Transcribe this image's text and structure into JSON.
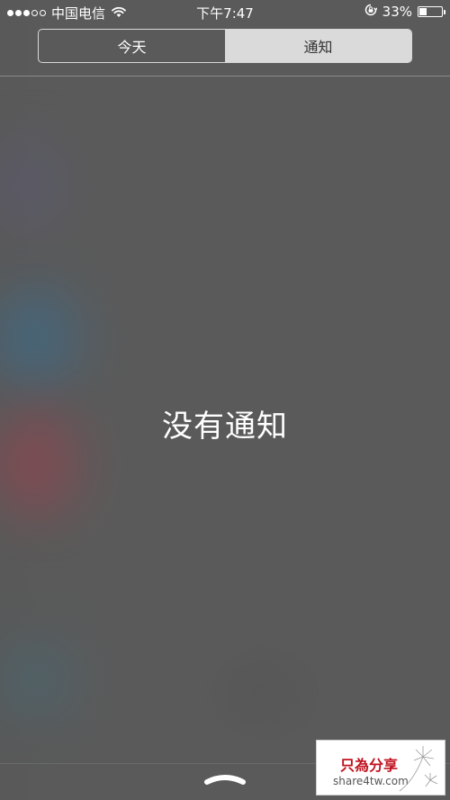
{
  "status_bar": {
    "signal_dots_full": 3,
    "signal_dots_total": 5,
    "carrier": "中国电信",
    "wifi_icon": "wifi-icon",
    "time": "下午7:47",
    "rotation_lock_icon": "rotation-lock-icon",
    "battery_text": "33%",
    "battery_level": 0.33
  },
  "segmented_control": {
    "tabs": [
      {
        "label": "今天",
        "selected": false
      },
      {
        "label": "通知",
        "selected": true
      }
    ]
  },
  "main": {
    "empty_message": "没有通知"
  },
  "bottom": {
    "grabber_icon": "grabber-icon"
  },
  "watermark": {
    "title": "只為分享",
    "url": "share4tw.com",
    "accent": "#c1121f"
  }
}
